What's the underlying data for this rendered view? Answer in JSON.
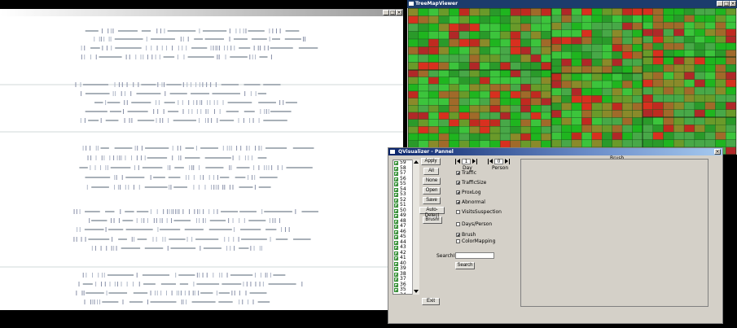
{
  "timeline_window": {
    "controls": {
      "minimize": "_",
      "maximize": "□",
      "close": "×"
    }
  },
  "treemap_window": {
    "title": "TreeMapViewer",
    "controls": {
      "minimize": "_",
      "maximize": "□",
      "close": "×"
    }
  },
  "panel": {
    "title": "QVisualizer - Pannel",
    "close": "×",
    "day_list": [
      "59",
      "58",
      "57",
      "56",
      "55",
      "54",
      "53",
      "52",
      "51",
      "50",
      "49",
      "48",
      "47",
      "46",
      "45",
      "44",
      "43",
      "42",
      "41",
      "40",
      "39",
      "38",
      "37",
      "36",
      "35",
      "34"
    ],
    "buttons": {
      "apply": "Apply",
      "all": "All",
      "none": "None",
      "open": "Open",
      "save": "Save",
      "auto_detect": "Auto-Detect",
      "brush": "Brush!",
      "exit": "Exit"
    },
    "day_spinner": {
      "label": "Day",
      "value": "1"
    },
    "person_spinner": {
      "label": "Person",
      "value": "0"
    },
    "options": [
      {
        "label": "Traffic",
        "checked": true
      },
      {
        "label": "TrafficSize",
        "checked": true
      },
      {
        "label": "ProxLog",
        "checked": true
      },
      {
        "label": "Abnormal",
        "checked": true
      },
      {
        "label": "VisitsSuspection",
        "checked": false
      },
      {
        "label": "Days/Person",
        "checked": false
      },
      {
        "label": "Brush",
        "checked": true
      },
      {
        "label": "ColorMapping",
        "checked": false
      }
    ],
    "search_label": "SearchIP",
    "search_value": "",
    "search_button": "Search",
    "brush_label": "Brush"
  }
}
